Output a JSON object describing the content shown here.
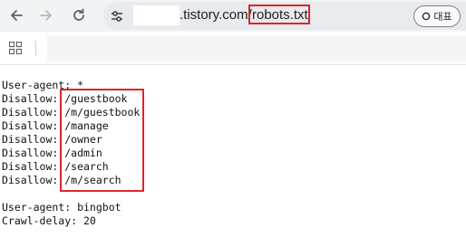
{
  "toolbar": {
    "url_host": ".tistory.com/",
    "url_path": "robots.txt",
    "translate_label": "대표"
  },
  "robots": {
    "group1_agent": "User-agent: *",
    "group1_rules": [
      "Disallow: /guestbook",
      "Disallow: /m/guestbook",
      "Disallow: /manage",
      "Disallow: /owner",
      "Disallow: /admin",
      "Disallow: /search",
      "Disallow: /m/search"
    ],
    "group2_agent": "User-agent: bingbot",
    "group2_delay": "Crawl-delay: 20"
  },
  "colors": {
    "highlight": "#d9262a",
    "toolbar_bg": "#f1f3f4",
    "omnibox_bg": "#e8eaed"
  },
  "icons": [
    "back-arrow-icon",
    "forward-arrow-icon",
    "reload-icon",
    "site-settings-icon",
    "apps-grid-icon"
  ]
}
